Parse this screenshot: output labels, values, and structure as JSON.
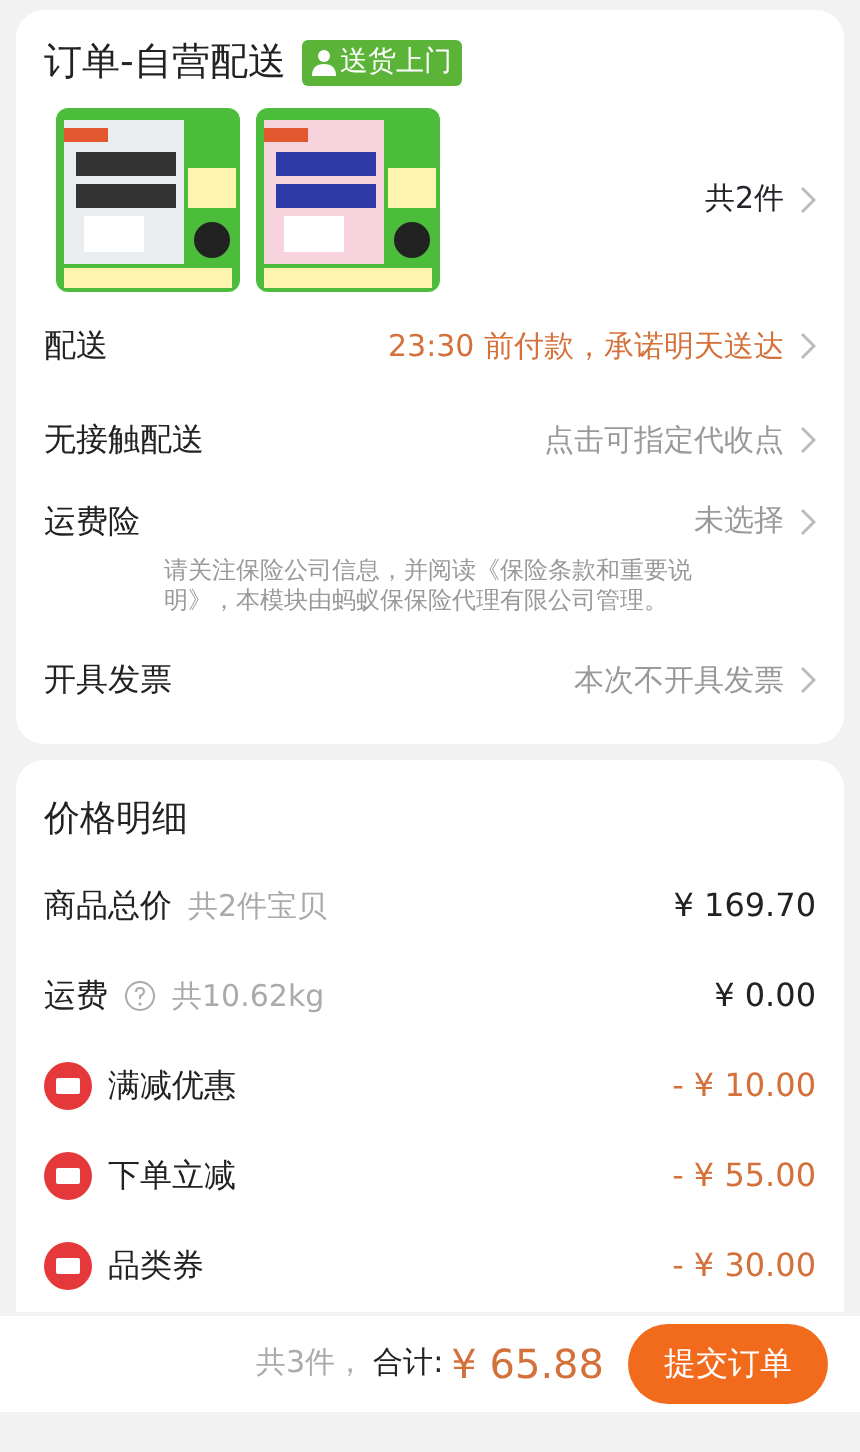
{
  "order": {
    "title": "订单-自营配送",
    "tag": "送货上门",
    "count": "共2件",
    "rows": [
      {
        "label": "配送",
        "value": "23:30 前付款，承诺明天送达",
        "highlight": true
      },
      {
        "label": "无接触配送",
        "value": "点击可指定代收点",
        "highlight": false
      },
      {
        "label": "运费险",
        "value": "未选择",
        "highlight": false,
        "note": "请关注保险公司信息，并阅读《保险条款和重要说明》，本模块由蚂蚁保保险代理有限公司管理。"
      },
      {
        "label": "开具发票",
        "value": "本次不开具发票",
        "highlight": false
      }
    ]
  },
  "price_detail": {
    "title": "价格明细",
    "rows": [
      {
        "kind": "total",
        "label": "商品总价",
        "sub": "共2件宝贝",
        "amount": "¥ 169.70"
      },
      {
        "kind": "shipping",
        "label": "运费",
        "sub": "共10.62kg",
        "amount": "¥ 0.00"
      },
      {
        "kind": "discount",
        "label": "满减优惠",
        "amount": "- ¥ 10.00"
      },
      {
        "kind": "discount",
        "label": "下单立减",
        "amount": "- ¥ 55.00"
      },
      {
        "kind": "discount",
        "label": "品类券",
        "amount": "- ¥ 30.00"
      }
    ]
  },
  "footer": {
    "count": "共3件，",
    "total_label": "合计:",
    "total": "¥ 65.88",
    "submit": "提交订单"
  }
}
